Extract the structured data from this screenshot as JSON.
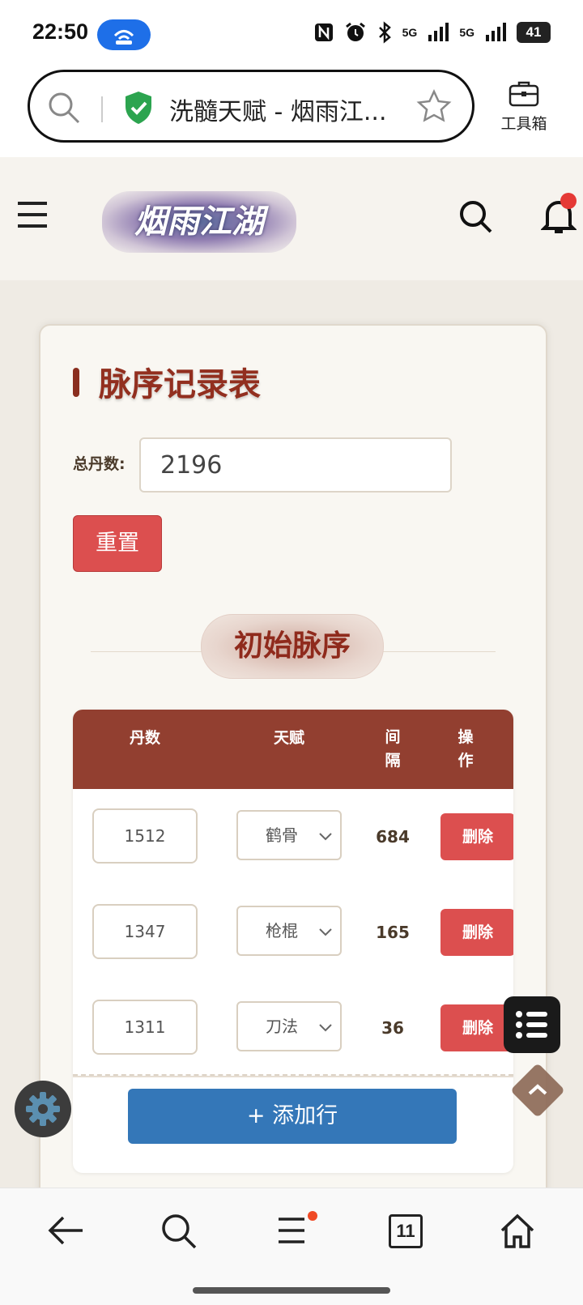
{
  "status_bar": {
    "time": "22:50",
    "signal_1": "5G",
    "signal_2": "5G",
    "battery": "41"
  },
  "browser": {
    "url_text": "洗髓天赋 - 烟雨江...",
    "toolbox_label": "工具箱"
  },
  "site_header": {
    "logo_text": "烟雨江湖"
  },
  "card": {
    "title": "脉序记录表",
    "total_label": "总丹数:",
    "total_value": "2196",
    "reset_label": "重置",
    "section_title": "初始脉序"
  },
  "table": {
    "headers": {
      "dan": "丹数",
      "talent": "天赋",
      "interval": "间隔",
      "action": "操作"
    },
    "rows": [
      {
        "dan": "1512",
        "talent": "鹤骨",
        "interval": "684",
        "delete": "删除"
      },
      {
        "dan": "1347",
        "talent": "枪棍",
        "interval": "165",
        "delete": "删除"
      },
      {
        "dan": "1311",
        "talent": "刀法",
        "interval": "36",
        "delete": "删除"
      }
    ],
    "add_row_label": "+ 添加行"
  },
  "bottom_nav": {
    "tab_count": "11"
  },
  "colors": {
    "brand_red": "#922f1f",
    "header_bg": "#923f30",
    "delete_red": "#dc4f4f",
    "add_blue": "#3477b8"
  }
}
